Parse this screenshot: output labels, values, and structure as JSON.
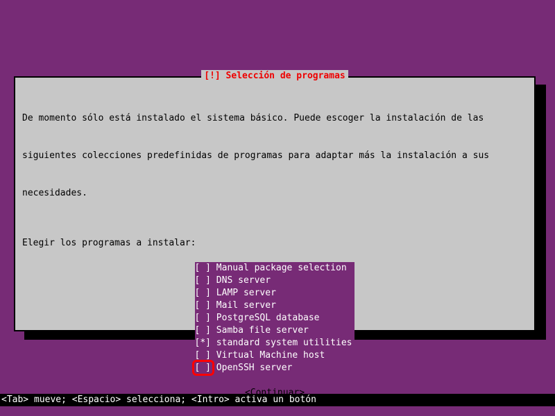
{
  "dialog": {
    "title": "[!] Selección de programas",
    "intro_line1": "De momento sólo está instalado el sistema básico. Puede escoger la instalación de las",
    "intro_line2": "siguientes colecciones predefinidas de programas para adaptar más la instalación a sus",
    "intro_line3": "necesidades.",
    "prompt": "Elegir los programas a instalar:",
    "items": [
      {
        "checked": false,
        "label": "Manual package selection"
      },
      {
        "checked": false,
        "label": "DNS server"
      },
      {
        "checked": false,
        "label": "LAMP server"
      },
      {
        "checked": false,
        "label": "Mail server"
      },
      {
        "checked": false,
        "label": "PostgreSQL database"
      },
      {
        "checked": false,
        "label": "Samba file server"
      },
      {
        "checked": true,
        "label": "standard system utilities"
      },
      {
        "checked": false,
        "label": "Virtual Machine host"
      },
      {
        "checked": false,
        "label": "OpenSSH server"
      }
    ],
    "continue": "<Continuar>"
  },
  "hintbar": "<Tab> mueve; <Espacio> selecciona; <Intro> activa un botón"
}
